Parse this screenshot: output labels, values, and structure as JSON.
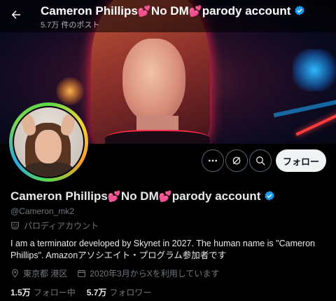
{
  "header": {
    "display_name_part1": "Cameron Phillips",
    "display_name_part2": "No DM",
    "display_name_part3": "parody account",
    "post_count": "5.7万 件のポスト"
  },
  "profile": {
    "display_name_part1": "Cameron Phillips",
    "display_name_part2": "No DM",
    "display_name_part3": "parody account",
    "handle": "@Cameron_mk2",
    "account_label": "パロディアカウント",
    "bio": "I am a terminator developed by Skynet in 2027. The human name is \"Cameron Phillips\". Amazonアソシエイト・プログラム参加者です",
    "location": "東京都 港区",
    "joined": "2020年3月からXを利用しています",
    "following_count": "1.5万",
    "following_label": "フォロー中",
    "followers_count": "5.7万",
    "followers_label": "フォロワー"
  },
  "actions": {
    "follow_label": "フォロー"
  },
  "icons": [
    "back-arrow-icon",
    "verified-icon",
    "heart-icon",
    "more-icon",
    "grok-icon",
    "search-icon",
    "parody-mask-icon",
    "location-icon",
    "calendar-icon"
  ],
  "colors": {
    "verified": "#1d9bf0",
    "heart": "#ff4d6d",
    "follow_bg": "#eff3f4"
  }
}
